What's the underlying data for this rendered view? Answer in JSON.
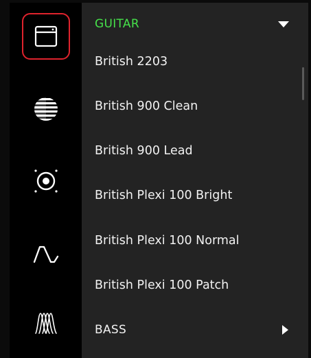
{
  "colors": {
    "accent_green": "#46e04a",
    "selection_red": "#e0232d",
    "panel_bg": "#232323",
    "sidebar_bg": "#000000",
    "text": "#f2f2f2"
  },
  "sidebar": {
    "items": [
      {
        "icon": "amp-head-icon",
        "selected": true
      },
      {
        "icon": "cabinet-speaker-icon",
        "selected": false
      },
      {
        "icon": "speaker-cone-icon",
        "selected": false
      },
      {
        "icon": "waveform-icon",
        "selected": false
      },
      {
        "icon": "multi-wave-icon",
        "selected": false
      }
    ]
  },
  "menu": {
    "guitar": {
      "label": "GUITAR",
      "expanded": true
    },
    "presets": [
      {
        "label": "British 2203"
      },
      {
        "label": "British 900 Clean"
      },
      {
        "label": "British 900 Lead"
      },
      {
        "label": "British Plexi 100 Bright"
      },
      {
        "label": "British Plexi 100 Normal"
      },
      {
        "label": "British Plexi 100 Patch"
      }
    ],
    "bass": {
      "label": "BASS",
      "expanded": false
    }
  }
}
